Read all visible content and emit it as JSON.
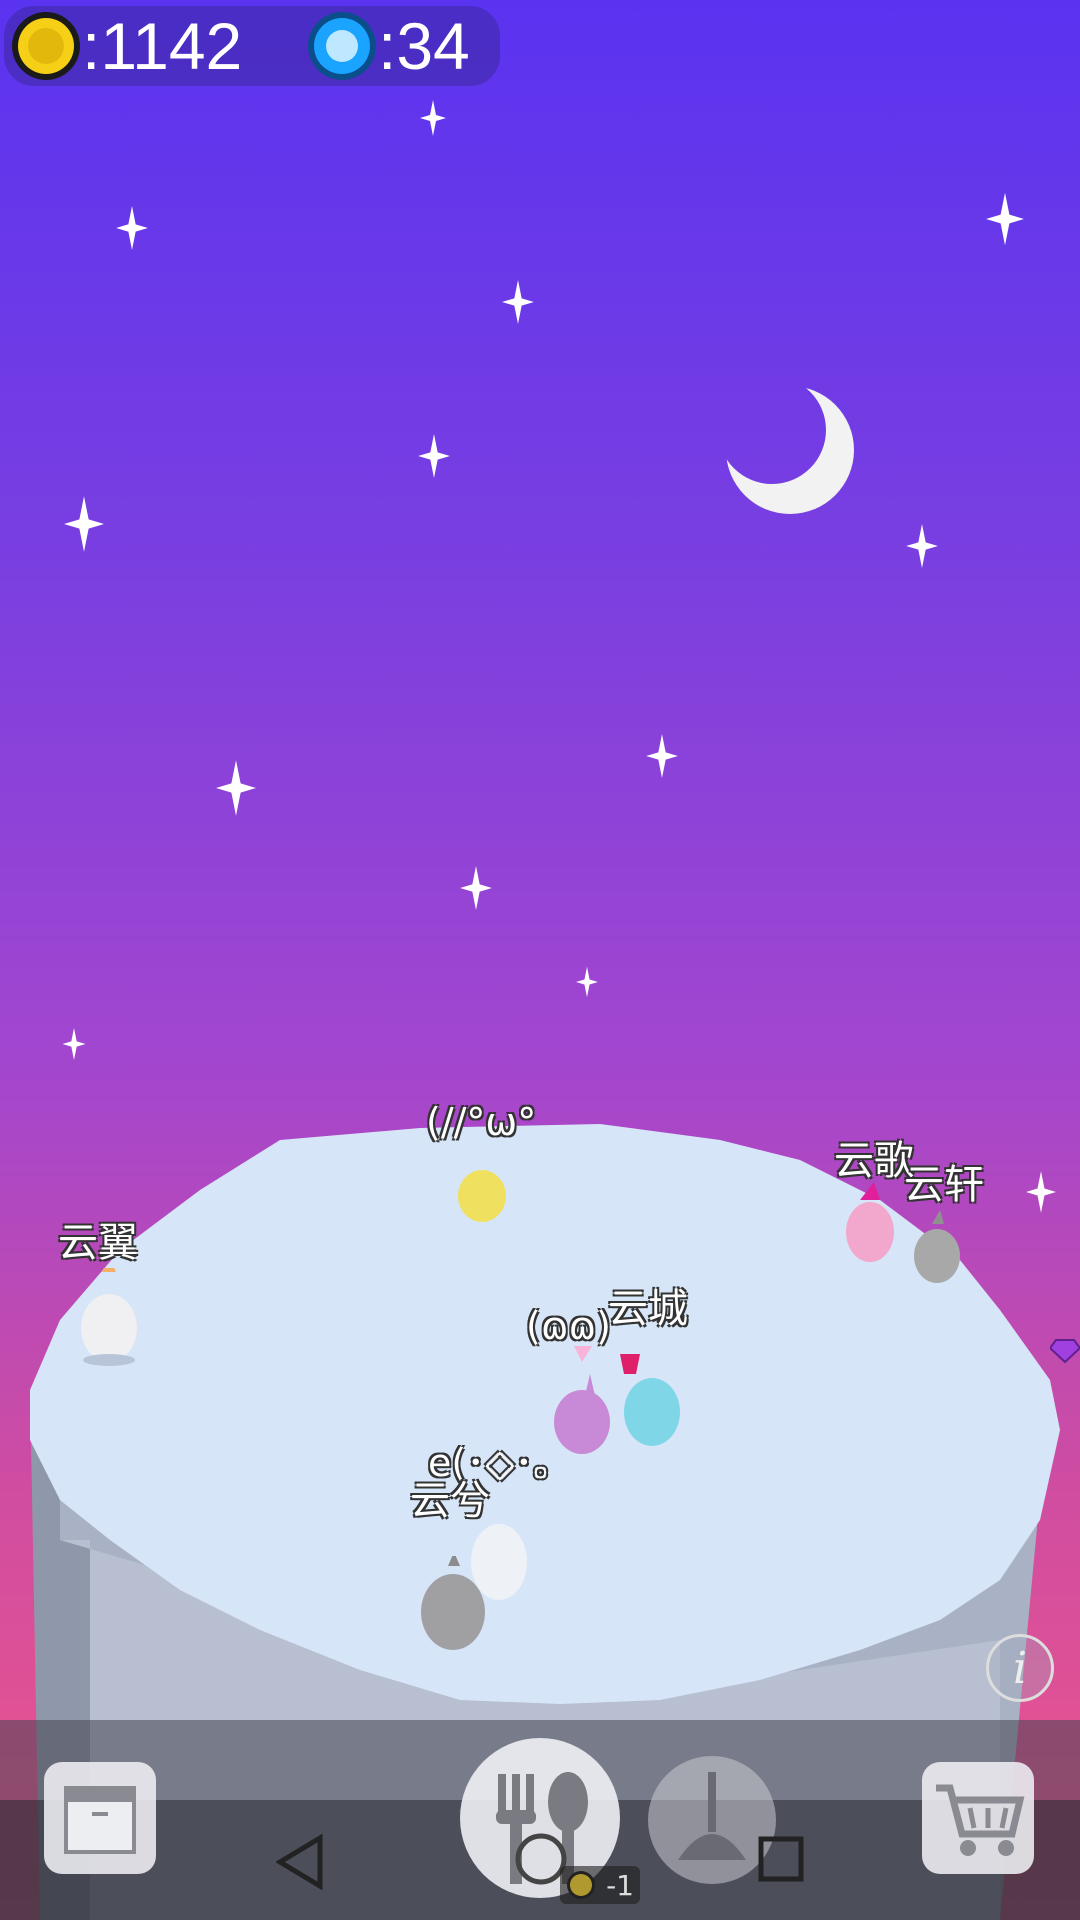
{
  "hud": {
    "coins_icon": "gold-coin-icon",
    "coins": ":1142",
    "gems_icon": "blue-gem-icon",
    "gems": ":34"
  },
  "characters": [
    {
      "name": "云翼"
    },
    {
      "name": "云歌"
    },
    {
      "name": "云轩"
    },
    {
      "name": "云城"
    },
    {
      "name": "云兮"
    }
  ],
  "emoticons": [
    "(//°ω°",
    "(ɷɷ)",
    "e(･◇･｡"
  ],
  "toolbar": {
    "left_icon": "storage-box-icon",
    "feed_icon": "fork-spoon-icon",
    "clean_icon": "plunger-icon",
    "shop_icon": "shopping-cart-icon",
    "feed_cost": "-1",
    "info_label": "i"
  },
  "nav": {
    "back_icon": "back-triangle-icon",
    "home_icon": "home-circle-icon",
    "recent_icon": "recent-square-icon"
  },
  "colors": {
    "sky_top": "#5a33f0",
    "sky_bottom": "#f0558a",
    "island_top": "#d6e6f8",
    "coin": "#f5d016",
    "gem": "#1aa3ff"
  }
}
